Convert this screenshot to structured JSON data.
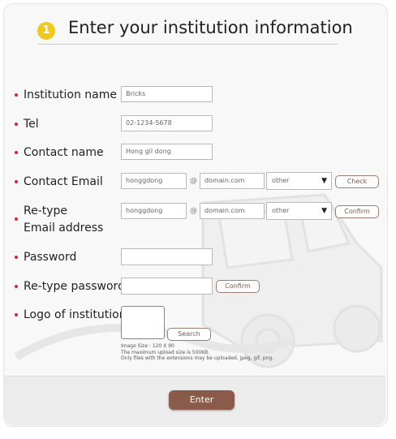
{
  "header": {
    "step_number": "1",
    "title": "Enter your institution information"
  },
  "labels": {
    "institution_name": "Institution name",
    "tel": "Tel",
    "contact_name": "Contact name",
    "contact_email": "Contact Email",
    "retype_line1": "Re-type",
    "retype_line2": "Email address",
    "password": "Password",
    "retype_password": "Re-type password",
    "logo": "Logo of institution"
  },
  "fields": {
    "institution_name": "Bricks",
    "tel": "02-1234-5678",
    "contact_name": "Hong gil dong",
    "email_id": "honggdong",
    "email_domain": "domain.com",
    "email_select": "other",
    "retype_email_id": "honggdong",
    "retype_email_domain": "domain.com",
    "retype_email_select": "other",
    "password": "",
    "retype_password": ""
  },
  "symbols": {
    "at": "@",
    "caret": "▼"
  },
  "buttons": {
    "check": "Check",
    "confirm_email": "Confirm",
    "confirm_password": "Confirm",
    "search": "Search",
    "enter": "Enter"
  },
  "notes": {
    "image_size": "Image Size : 120 X 90",
    "max_upload": "The maximum upload size is 500KB.",
    "extensions": "Only files with the extensions may be uploaded. jpeg, gif, png."
  },
  "colors": {
    "required_dot": "#d9262c",
    "step_badge": "#f2c81e",
    "enter_button": "#8a5b4a"
  }
}
